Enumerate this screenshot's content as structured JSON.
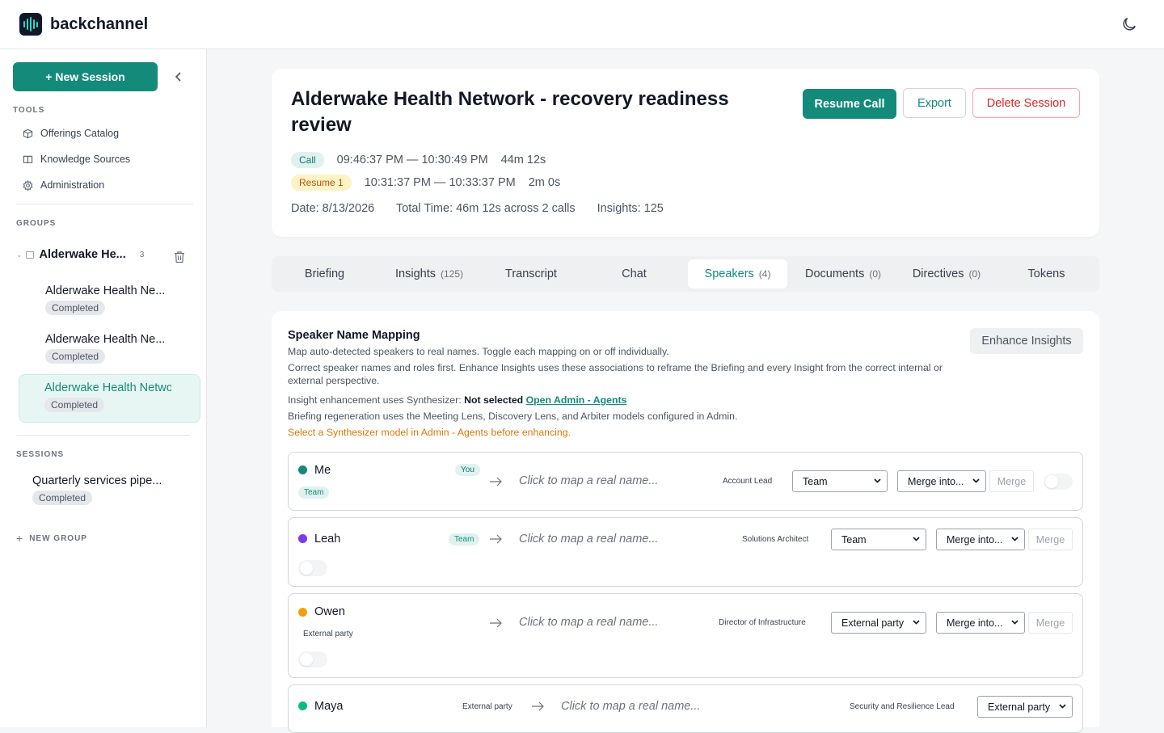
{
  "app": {
    "name": "backchannel"
  },
  "sidebar": {
    "new_session": "+ New Session",
    "tools_label": "TOOLS",
    "tools": [
      {
        "label": "Offerings Catalog",
        "icon": "box-icon"
      },
      {
        "label": "Knowledge Sources",
        "icon": "book-icon"
      },
      {
        "label": "Administration",
        "icon": "gear-icon"
      }
    ],
    "groups_label": "GROUPS",
    "group": {
      "name": "Alderwake He...",
      "count": "3"
    },
    "group_sessions": [
      {
        "title": "Alderwake Health Ne...",
        "status": "Completed"
      },
      {
        "title": "Alderwake Health Ne...",
        "status": "Completed"
      },
      {
        "title": "Alderwake Health Network - recovery readiness review",
        "status": "Completed"
      }
    ],
    "sessions_label": "SESSIONS",
    "sessions": [
      {
        "title": "Quarterly services pipe...",
        "status": "Completed"
      }
    ],
    "new_group": "NEW GROUP"
  },
  "session": {
    "title": "Alderwake Health Network - recovery readiness review",
    "buttons": {
      "resume": "Resume Call",
      "export": "Export",
      "delete": "Delete Session"
    },
    "calls": [
      {
        "tag": "Call",
        "range": "09:46:37 PM — 10:30:49 PM",
        "duration": "44m 12s"
      },
      {
        "tag": "Resume 1",
        "range": "10:31:37 PM — 10:33:37 PM",
        "duration": "2m 0s"
      }
    ],
    "date": "Date: 8/13/2026",
    "total": "Total Time: 46m 12s across 2 calls",
    "insights": "Insights: 125"
  },
  "tabs": [
    {
      "label": "Briefing",
      "count": ""
    },
    {
      "label": "Insights",
      "count": "(125)"
    },
    {
      "label": "Transcript",
      "count": ""
    },
    {
      "label": "Chat",
      "count": ""
    },
    {
      "label": "Speakers",
      "count": "(4)"
    },
    {
      "label": "Documents",
      "count": "(0)"
    },
    {
      "label": "Directives",
      "count": "(0)"
    },
    {
      "label": "Tokens",
      "count": ""
    }
  ],
  "panel": {
    "title": "Speaker Name Mapping",
    "enhance": "Enhance Insights",
    "desc1": "Map auto-detected speakers to real names. Toggle each mapping on or off individually.",
    "desc2": "Correct speaker names and roles first. Enhance Insights uses these associations to reframe the Briefing and every Insight from the correct internal or external perspective.",
    "synth_prefix": "Insight enhancement uses Synthesizer: ",
    "synth_value": "Not selected",
    "synth_link": "Open Admin - Agents",
    "briefing_note": "Briefing regeneration uses the Meeting Lens, Discovery Lens, and Arbiter models configured in Admin.",
    "warning": "Select a Synthesizer model in Admin - Agents before enhancing.",
    "placeholder": "Click to map a real name...",
    "merge_placeholder": "Merge into...",
    "merge_btn": "Merge"
  },
  "speakers": [
    {
      "name": "Me",
      "color": "#148a7a",
      "badge": "You",
      "affiliation": "Team",
      "role": "Account Lead",
      "type": "Team"
    },
    {
      "name": "Leah",
      "color": "#7c3aed",
      "affiliation": "Team",
      "role": "Solutions Architect",
      "type": "Team"
    },
    {
      "name": "Owen",
      "color": "#f59e0b",
      "affiliation": "External party",
      "role": "Director of Infrastructure",
      "type": "External party"
    },
    {
      "name": "Maya",
      "color": "#10b981",
      "affiliation": "External party",
      "role": "Security and Resilience Lead",
      "type": "External party"
    }
  ]
}
